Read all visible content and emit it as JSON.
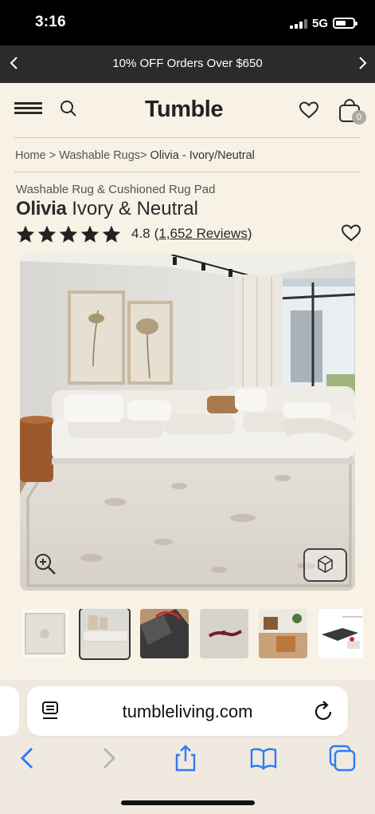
{
  "status_bar": {
    "time": "3:16",
    "network": "5G"
  },
  "promo": {
    "text": "10% OFF Orders Over $650"
  },
  "header": {
    "logo": "Tumble",
    "cart_count": "0"
  },
  "breadcrumb": {
    "home": "Home",
    "sep1": " > ",
    "category": "Washable Rugs",
    "sep2": "> ",
    "current": "Olivia - Ivory/Neutral"
  },
  "product": {
    "subtitle": "Washable Rug & Cushioned Rug Pad",
    "name": "Olivia",
    "variant": " Ivory & Neutral",
    "rating": "4.8",
    "reviews_open": "(",
    "reviews": "1,652 Reviews",
    "reviews_close": ")",
    "stars": 5
  },
  "browser": {
    "url": "tumbleliving.com"
  },
  "colors": {
    "background": "#f7f1e6",
    "promo_bg": "#2b2b2b",
    "ios_blue": "#2f7bf5"
  },
  "icons": [
    "menu-icon",
    "search-icon",
    "heart-icon",
    "cart-icon",
    "zoom-icon",
    "3d-view-icon",
    "reader-icon",
    "reload-icon",
    "back-icon",
    "forward-icon",
    "share-icon",
    "bookmarks-icon",
    "tabs-icon"
  ]
}
